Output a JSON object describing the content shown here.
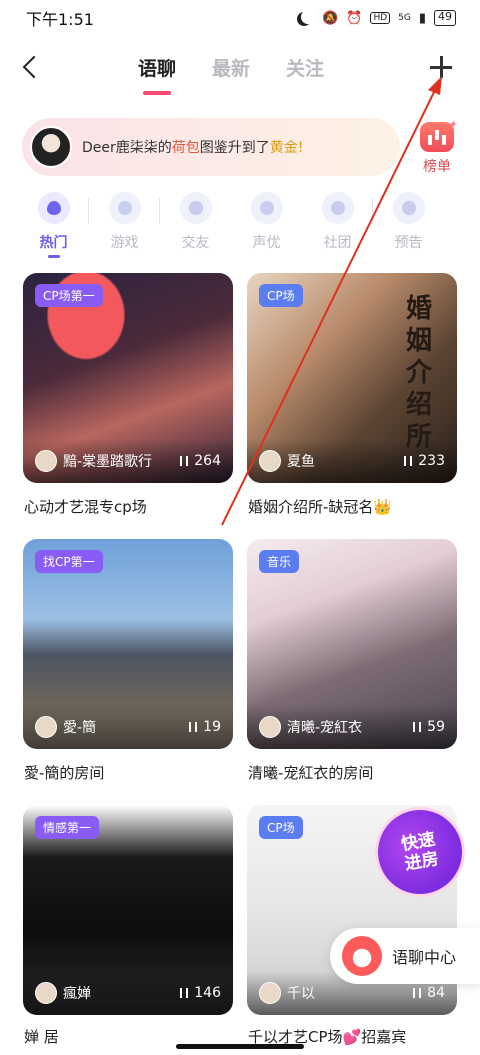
{
  "status_bar": {
    "time": "下午1:51",
    "network": "5G",
    "battery": "49"
  },
  "top_nav": {
    "tabs": [
      {
        "label": "语聊",
        "active": true
      },
      {
        "label": "最新",
        "active": false
      },
      {
        "label": "关注",
        "active": false
      }
    ]
  },
  "notice": {
    "prefix": "Deer鹿柒柒的",
    "item": "荷包",
    "middle": "图鉴升到了",
    "level": "黄金",
    "suffix": "!"
  },
  "rank": {
    "label": "榜单"
  },
  "categories": [
    {
      "label": "热门",
      "active": true
    },
    {
      "label": "游戏",
      "active": false
    },
    {
      "label": "交友",
      "active": false
    },
    {
      "label": "声优",
      "active": false
    },
    {
      "label": "社团",
      "active": false
    },
    {
      "label": "预告",
      "active": false
    }
  ],
  "rooms": [
    {
      "badge": "CP场第一",
      "host": "黯-棠墨踏歌行",
      "count": "264",
      "title": "心动才艺混专cp场"
    },
    {
      "badge": "CP场",
      "host": "夏鱼",
      "count": "233",
      "title": "婚姻介绍所-缺冠名👑",
      "art_text": "婚姻介绍所"
    },
    {
      "badge": "找CP第一",
      "host": "愛-簡",
      "count": "19",
      "title": "愛-簡的房间"
    },
    {
      "badge": "音乐",
      "host": "清曦-宠紅衣",
      "count": "59",
      "title": "清曦-宠紅衣的房间"
    },
    {
      "badge": "情感第一",
      "host": "瘋婵",
      "count": "146",
      "title": "婵 居"
    },
    {
      "badge": "CP场",
      "host": "千以",
      "count": "84",
      "title": "千以才艺CP场💕招嘉宾"
    }
  ],
  "quick_enter": {
    "label_top": "快速",
    "label_bottom": "进房"
  },
  "chat_center": {
    "label": "语聊中心"
  },
  "colors": {
    "accent_pink": "#ff4a74",
    "accent_purple": "#6a5df0",
    "annotation_red": "#e0301e"
  }
}
